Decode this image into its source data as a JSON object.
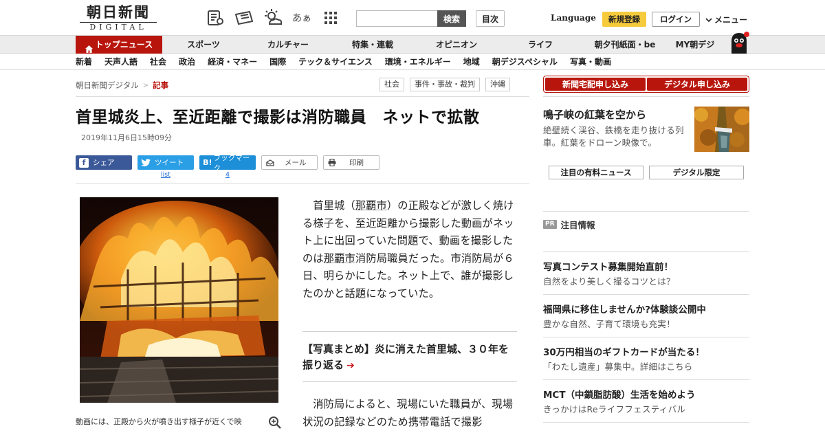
{
  "header": {
    "logo_main": "朝日新聞",
    "logo_sub": "DIGITAL",
    "search_button": "検索",
    "search_placeholder": "",
    "toc_button": "目次",
    "language": "Language",
    "register": "新規登録",
    "login": "ログイン",
    "menu": "メニュー",
    "font_icon_label": "あぁ"
  },
  "nav_main": [
    {
      "label": "トップニュース",
      "active": true
    },
    {
      "label": "スポーツ"
    },
    {
      "label": "カルチャー"
    },
    {
      "label": "特集・連載"
    },
    {
      "label": "オピニオン"
    },
    {
      "label": "ライフ"
    },
    {
      "label": "朝夕刊紙面・be"
    },
    {
      "label": "MY朝デジ"
    }
  ],
  "nav_sub": [
    "新着",
    "天声人語",
    "社会",
    "政治",
    "経済・マネー",
    "国際",
    "テック＆サイエンス",
    "環境・エネルギー",
    "地域",
    "朝デジスペシャル",
    "写真・動画"
  ],
  "breadcrumb": {
    "home": "朝日新聞デジタル",
    "sep": ">",
    "current": "記事"
  },
  "tags": [
    "社会",
    "事件・事故・裁判",
    "沖縄"
  ],
  "article": {
    "headline": "首里城炎上、至近距離で撮影は消防職員　ネットで拡散",
    "date": "2019年11月6日15時09分",
    "share": {
      "facebook": "シェア",
      "twitter": "ツイート",
      "twitter_count": "list",
      "hatena": "ブックマーク",
      "hatena_count": "4",
      "mail": "メール",
      "print": "印刷"
    },
    "caption": "動画には、正殿から火が噴き出す様子が近くで映",
    "para1_a": "首里城（",
    "para1_link1": "那覇市",
    "para1_b": "）の正殿などが激しく焼ける様子を、至近距離から撮影した動画がネット上に出回っていた問題で、動画を撮影したのは",
    "para1_link2": "那覇市",
    "para1_c": "消防局職員だった。市消防局が６日、明らかにした。ネット上で、誰が撮影したのかと話題になっていた。",
    "related": "【写真まとめ】炎に消えた首里城、３０年を振り返る",
    "para2": "消防局によると、現場にいた職員が、現場状況の記録などのため携帯電話で撮影"
  },
  "sidebar": {
    "subscribe_paper": "新聞宅配申し込み",
    "subscribe_digital": "デジタル申し込み",
    "feature_title": "鳴子峡の紅葉を空から",
    "feature_desc": "絶壁続く渓谷、鉄橋を走り抜ける列車。紅葉をドローン映像で。",
    "tab_paid": "注目の有料ニュース",
    "tab_digital": "デジタル限定",
    "pr_badge": "PR",
    "pr_label": "注目情報",
    "ads": [
      {
        "title": "写真コンテスト募集開始直前！",
        "desc": "自然をより美しく撮るコツとは？"
      },
      {
        "title": "福岡県に移住しませんか?体験談公開中",
        "desc": "豊かな自然、子育て環境も充実！"
      },
      {
        "title": "30万円相当のギフトカードが当たる！",
        "desc": "「わたし遺産」募集中。詳細はこちら"
      },
      {
        "title": "MCT（中鎖脂肪酸）生活を始めよう",
        "desc": "きっかけはReライフフェスティバル"
      }
    ]
  },
  "colors": {
    "brand_red": "#b8160d",
    "register_yellow": "#f5cb3c",
    "facebook": "#3b5998",
    "twitter": "#2a9fe6",
    "hatena": "#1c8fd8"
  }
}
